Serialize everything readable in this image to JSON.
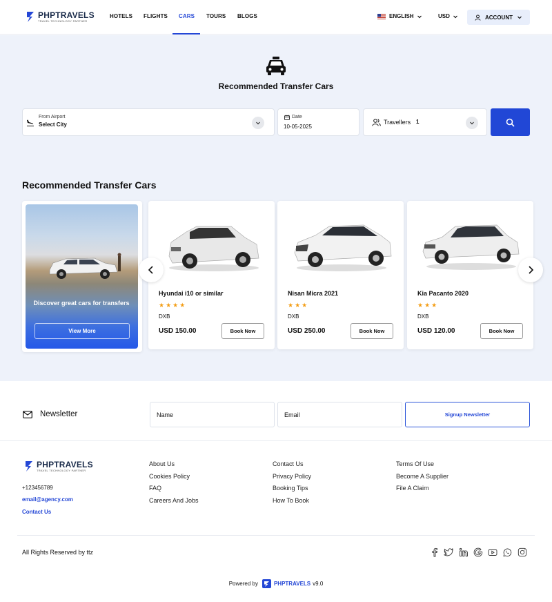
{
  "header": {
    "brand": "PHPTRAVELS",
    "tagline": "TRAVEL TECHNOLOGY PARTNER",
    "nav": [
      "HOTELS",
      "FLIGHTS",
      "CARS",
      "TOURS",
      "BLOGS"
    ],
    "active_nav": "CARS",
    "language": "ENGLISH",
    "currency": "USD",
    "account": "ACCOUNT"
  },
  "hero": {
    "title": "Recommended Transfer Cars",
    "from_label": "From Airport",
    "from_value": "Select City",
    "date_label": "Date",
    "date_value": "10-05-2025",
    "travellers_label": "Travellers",
    "travellers_value": "1"
  },
  "section_title": "Recommended Transfer Cars",
  "promo": {
    "text": "Discover great cars for transfers",
    "button": "View More"
  },
  "cars": [
    {
      "name": "Hyundai i10 or similar",
      "stars": 4,
      "location": "DXB",
      "price": "USD 150.00",
      "button": "Book Now"
    },
    {
      "name": "Nisan Micra 2021",
      "stars": 3,
      "location": "DXB",
      "price": "USD 250.00",
      "button": "Book Now"
    },
    {
      "name": "Kia Pacanto 2020",
      "stars": 3,
      "location": "DXB",
      "price": "USD 120.00",
      "button": "Book Now"
    }
  ],
  "newsletter": {
    "title": "Newsletter",
    "name_placeholder": "Name",
    "email_placeholder": "Email",
    "button": "Signup Newsletter"
  },
  "footer": {
    "phone": "+123456789",
    "email": "email@agency.com",
    "contact": "Contact Us",
    "col1": [
      "About Us",
      "Cookies Policy",
      "FAQ",
      "Careers And Jobs"
    ],
    "col2": [
      "Contact Us",
      "Privacy Policy",
      "Booking Tips",
      "How To Book"
    ],
    "col3": [
      "Terms Of Use",
      "Become A Supplier",
      "File A Claim"
    ],
    "copyright": "All Rights Reserved by ttz",
    "social_icons": [
      "facebook-icon",
      "twitter-icon",
      "linkedin-icon",
      "google-icon",
      "youtube-icon",
      "whatsapp-icon",
      "instagram-icon"
    ],
    "powered_by": "Powered by",
    "powered_brand": "PHPTRAVELS",
    "version": "v9.0"
  },
  "colors": {
    "accent": "#2147d6",
    "star": "#f39c12",
    "hero_bg": "#eef2fa"
  }
}
